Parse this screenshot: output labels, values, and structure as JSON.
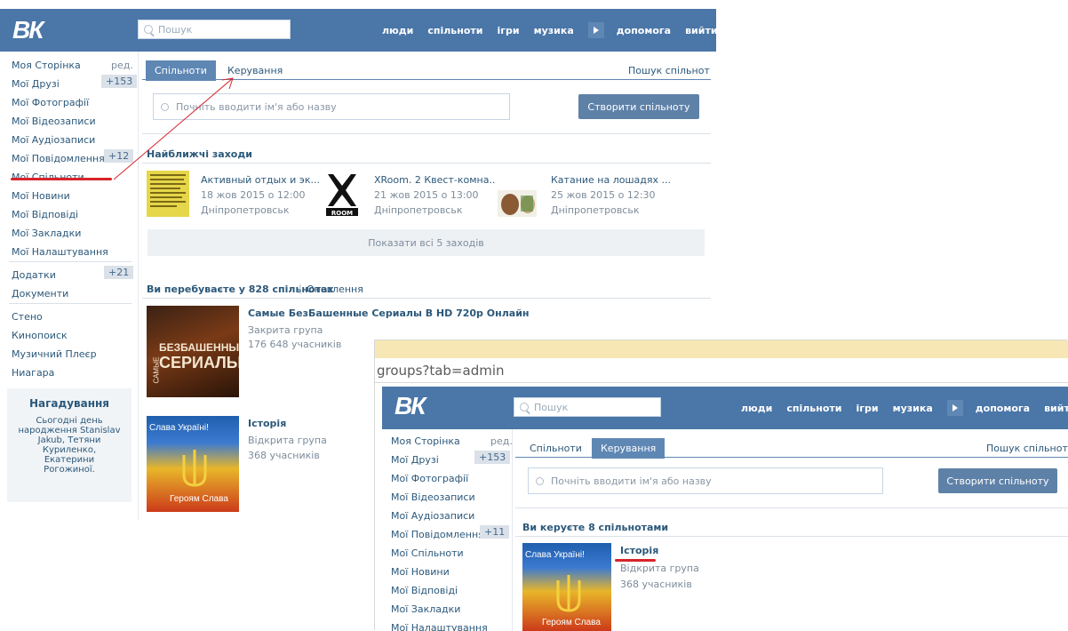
{
  "top": {
    "logo": "ВК",
    "search_placeholder": "Пошук",
    "nav": [
      "люди",
      "спільноти",
      "ігри",
      "музика"
    ],
    "nav2": [
      "допомога",
      "вийти"
    ]
  },
  "sidebar": {
    "edit": "ред.",
    "items": [
      "Моя Сторінка",
      "Мої Друзі",
      "Мої Фотографії",
      "Мої Відеозаписи",
      "Мої Аудіозаписи",
      "Мої Повідомлення",
      "Мої Спільноти",
      "Мої Новини",
      "Мої Відповіді",
      "Мої Закладки",
      "Мої Налаштування"
    ],
    "friends_badge": "+153",
    "messages_badge": "+12",
    "apps": "Додатки",
    "apps_badge": "+21",
    "docs": "Документи",
    "links": [
      "Стено",
      "Кинопоиск",
      "Музичний Плеєр",
      "Ниагара"
    ],
    "reminder_title": "Нагадування",
    "reminder_text": [
      "Сьогодні день",
      "народження Stanislav",
      "Jakub, Тетяни",
      "Куриленко,",
      "Екатерини",
      "Рогожиної."
    ]
  },
  "main": {
    "tab_communities": "Спільноти",
    "tab_manage": "Керування",
    "search_communities": "Пошук спільнот",
    "input_placeholder": "Почніть вводити ім'я або назву",
    "create_btn": "Створити спільноту",
    "events_title": "Найближчі заходи",
    "events": [
      {
        "name": "Активный отдых и эк...",
        "date": "18 жов 2015 о 12:00",
        "city": "Дніпропетровськ"
      },
      {
        "name": "XRoom. 2 Квест-комна...",
        "date": "21 жов 2015 о 13:00",
        "city": "Дніпропетровськ"
      },
      {
        "name": "Катание на лошадях ...",
        "date": "25 жов 2015 о 12:30",
        "city": "Дніпропетровськ"
      }
    ],
    "show_all": "Показати всі 5 заходів",
    "member_title": "Ви перебуваєте у 828 спільнотах",
    "updates": "Оновлення",
    "groups": [
      {
        "name": "Самые БезБашенные Сериалы В HD 720p Онлайн",
        "type": "Закрита група",
        "members": "176 648 учасників",
        "img_text1": "БЕЗБАШЕННЫЕ",
        "img_text2": "СЕРИАЛЫ",
        "img_side": "САМЫЕ"
      },
      {
        "name": "Історія",
        "type": "Відкрита група",
        "members": "368 учасників",
        "img_text1": "Слава Україні!",
        "img_text2": "Героям Слава"
      }
    ]
  },
  "overlay": {
    "url": "groups?tab=admin",
    "search_communities": "Пошук спільнот",
    "messages_badge": "+11",
    "manage_title": "Ви керуєте 8 спільнотами",
    "group": {
      "name": "Історія",
      "type": "Відкрита група",
      "members": "368 учасників",
      "img_text1": "Слава Україні!",
      "img_text2": "Героям Слава"
    }
  },
  "colors": {
    "header": "#4a76a8",
    "accent": "#5f87b4",
    "annotation": "#d8232a"
  }
}
